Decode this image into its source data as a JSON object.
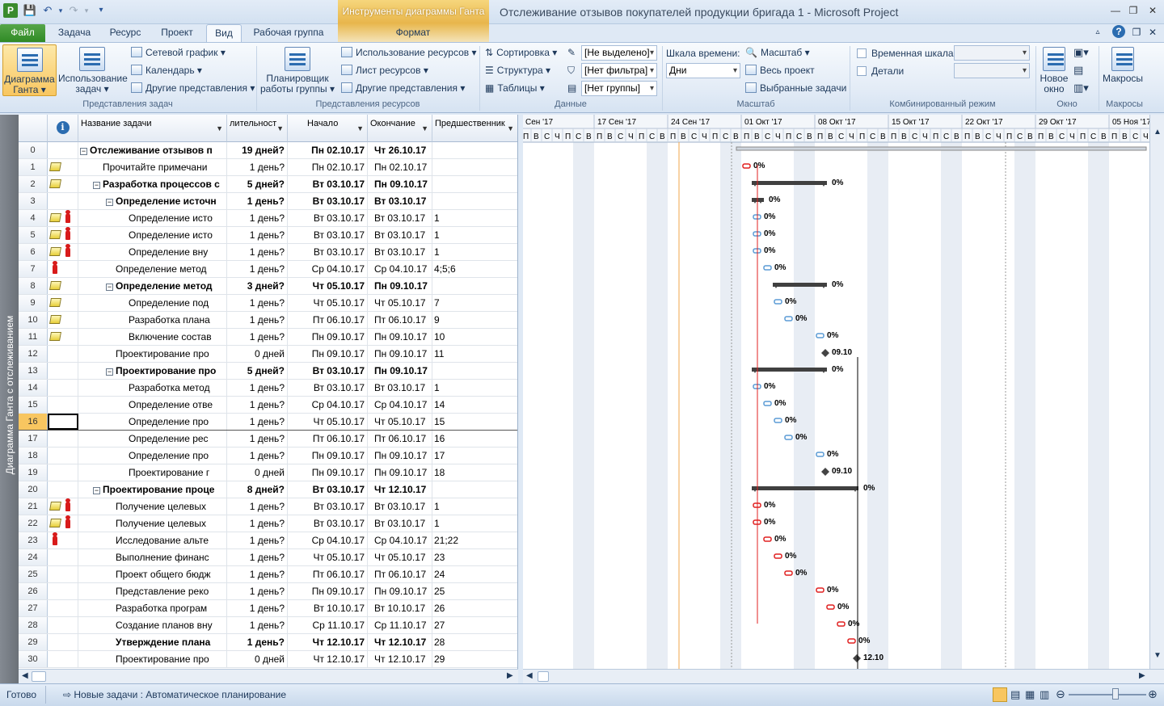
{
  "app": {
    "title": "Отслеживание отзывов покупателей продукции бригада 1  -  Microsoft Project",
    "context_tools": "Инструменты диаграммы Ганта",
    "logo": "P"
  },
  "tabs": [
    "Файл",
    "Задача",
    "Ресурс",
    "Проект",
    "Вид",
    "Рабочая группа",
    "Формат"
  ],
  "ribbon": {
    "task_views": {
      "gantt": "Диаграмма Ганта",
      "task_usage": "Использование задач",
      "network": "Сетевой график",
      "calendar": "Календарь",
      "other": "Другие представления",
      "label": "Представления задач"
    },
    "resource_views": {
      "planner": "Планировщик работы группы",
      "usage": "Использование ресурсов",
      "sheet": "Лист ресурсов",
      "other": "Другие представления",
      "label": "Представления ресурсов"
    },
    "data": {
      "sort": "Сортировка",
      "outline": "Структура",
      "tables": "Таблицы",
      "highlight": "[Не выделено]",
      "filter": "[Нет фильтра]",
      "group": "[Нет группы]",
      "label": "Данные"
    },
    "zoom": {
      "timescale": "Шкала времени:",
      "timescale_value": "Дни",
      "zoom": "Масштаб",
      "whole_project": "Весь проект",
      "selected": "Выбранные задачи",
      "label": "Масштаб"
    },
    "split": {
      "timeline": "Временная шкала",
      "details": "Детали",
      "label": "Комбинированный режим"
    },
    "window": {
      "new": "Новое окно",
      "label": "Окно"
    },
    "macros": {
      "btn": "Макросы",
      "label": "Макросы"
    }
  },
  "sidebar_label": "Диаграмма Ганта с отслеживанием",
  "columns": {
    "info": "i",
    "name": "Название задачи",
    "duration": "лительност",
    "start": "Начало",
    "finish": "Окончание",
    "pred": "Предшественник"
  },
  "timescale": {
    "weeks": [
      "Сен '17",
      "17 Сен '17",
      "24 Сен '17",
      "01 Окт '17",
      "08 Окт '17",
      "15 Окт '17",
      "22 Окт '17",
      "29 Окт '17",
      "05 Ноя '17"
    ],
    "days": [
      "П",
      "В",
      "С",
      "Ч",
      "П",
      "С",
      "В"
    ]
  },
  "tasks": [
    {
      "id": "0",
      "name": "Отслеживание отзывов п",
      "dur": "19 дней?",
      "start": "Пн 02.10.17",
      "finish": "Чт 26.10.17",
      "pred": "",
      "bold": true,
      "lvl": 0,
      "sum": true,
      "note": false,
      "res": false,
      "pct": "0%"
    },
    {
      "id": "1",
      "name": "Прочитайте примечани",
      "dur": "1 день?",
      "start": "Пн 02.10.17",
      "finish": "Пн 02.10.17",
      "pred": "",
      "bold": false,
      "lvl": 1,
      "sum": false,
      "note": true,
      "res": false,
      "pct": "0%"
    },
    {
      "id": "2",
      "name": "Разработка процессов с",
      "dur": "5 дней?",
      "start": "Вт 03.10.17",
      "finish": "Пн 09.10.17",
      "pred": "",
      "bold": true,
      "lvl": 1,
      "sum": true,
      "note": true,
      "res": false,
      "pct": "0%"
    },
    {
      "id": "3",
      "name": "Определение источн",
      "dur": "1 день?",
      "start": "Вт 03.10.17",
      "finish": "Вт 03.10.17",
      "pred": "",
      "bold": true,
      "lvl": 2,
      "sum": true,
      "note": false,
      "res": false,
      "pct": "0%"
    },
    {
      "id": "4",
      "name": "Определение исто",
      "dur": "1 день?",
      "start": "Вт 03.10.17",
      "finish": "Вт 03.10.17",
      "pred": "1",
      "bold": false,
      "lvl": 3,
      "sum": false,
      "note": true,
      "res": true,
      "pct": "0%"
    },
    {
      "id": "5",
      "name": "Определение исто",
      "dur": "1 день?",
      "start": "Вт 03.10.17",
      "finish": "Вт 03.10.17",
      "pred": "1",
      "bold": false,
      "lvl": 3,
      "sum": false,
      "note": true,
      "res": true,
      "pct": "0%"
    },
    {
      "id": "6",
      "name": "Определение вну",
      "dur": "1 день?",
      "start": "Вт 03.10.17",
      "finish": "Вт 03.10.17",
      "pred": "1",
      "bold": false,
      "lvl": 3,
      "sum": false,
      "note": true,
      "res": true,
      "pct": "0%"
    },
    {
      "id": "7",
      "name": "Определение метод",
      "dur": "1 день?",
      "start": "Ср 04.10.17",
      "finish": "Ср 04.10.17",
      "pred": "4;5;6",
      "bold": false,
      "lvl": 2,
      "sum": false,
      "note": false,
      "res": true,
      "pct": "0%"
    },
    {
      "id": "8",
      "name": "Определение метод",
      "dur": "3 дней?",
      "start": "Чт 05.10.17",
      "finish": "Пн 09.10.17",
      "pred": "",
      "bold": true,
      "lvl": 2,
      "sum": true,
      "note": true,
      "res": false,
      "pct": "0%"
    },
    {
      "id": "9",
      "name": "Определение под",
      "dur": "1 день?",
      "start": "Чт 05.10.17",
      "finish": "Чт 05.10.17",
      "pred": "7",
      "bold": false,
      "lvl": 3,
      "sum": false,
      "note": true,
      "res": false,
      "pct": "0%"
    },
    {
      "id": "10",
      "name": "Разработка плана",
      "dur": "1 день?",
      "start": "Пт 06.10.17",
      "finish": "Пт 06.10.17",
      "pred": "9",
      "bold": false,
      "lvl": 3,
      "sum": false,
      "note": true,
      "res": false,
      "pct": "0%"
    },
    {
      "id": "11",
      "name": "Включение состав",
      "dur": "1 день?",
      "start": "Пн 09.10.17",
      "finish": "Пн 09.10.17",
      "pred": "10",
      "bold": false,
      "lvl": 3,
      "sum": false,
      "note": true,
      "res": false,
      "pct": "0%"
    },
    {
      "id": "12",
      "name": "Проектирование про",
      "dur": "0 дней",
      "start": "Пн 09.10.17",
      "finish": "Пн 09.10.17",
      "pred": "11",
      "bold": false,
      "lvl": 2,
      "sum": false,
      "note": false,
      "res": false,
      "pct": "09.10"
    },
    {
      "id": "13",
      "name": "Проектирование про",
      "dur": "5 дней?",
      "start": "Вт 03.10.17",
      "finish": "Пн 09.10.17",
      "pred": "",
      "bold": true,
      "lvl": 2,
      "sum": true,
      "note": false,
      "res": false,
      "pct": "0%"
    },
    {
      "id": "14",
      "name": "Разработка метод",
      "dur": "1 день?",
      "start": "Вт 03.10.17",
      "finish": "Вт 03.10.17",
      "pred": "1",
      "bold": false,
      "lvl": 3,
      "sum": false,
      "note": false,
      "res": false,
      "pct": "0%"
    },
    {
      "id": "15",
      "name": "Определение отве",
      "dur": "1 день?",
      "start": "Ср 04.10.17",
      "finish": "Ср 04.10.17",
      "pred": "14",
      "bold": false,
      "lvl": 3,
      "sum": false,
      "note": false,
      "res": false,
      "pct": "0%"
    },
    {
      "id": "16",
      "name": "Определение про",
      "dur": "1 день?",
      "start": "Чт 05.10.17",
      "finish": "Чт 05.10.17",
      "pred": "15",
      "bold": false,
      "lvl": 3,
      "sum": false,
      "note": false,
      "res": false,
      "pct": "0%"
    },
    {
      "id": "17",
      "name": "Определение рес",
      "dur": "1 день?",
      "start": "Пт 06.10.17",
      "finish": "Пт 06.10.17",
      "pred": "16",
      "bold": false,
      "lvl": 3,
      "sum": false,
      "note": false,
      "res": false,
      "pct": "0%"
    },
    {
      "id": "18",
      "name": "Определение про",
      "dur": "1 день?",
      "start": "Пн 09.10.17",
      "finish": "Пн 09.10.17",
      "pred": "17",
      "bold": false,
      "lvl": 3,
      "sum": false,
      "note": false,
      "res": false,
      "pct": "0%"
    },
    {
      "id": "19",
      "name": "Проектирование г",
      "dur": "0 дней",
      "start": "Пн 09.10.17",
      "finish": "Пн 09.10.17",
      "pred": "18",
      "bold": false,
      "lvl": 3,
      "sum": false,
      "note": false,
      "res": false,
      "pct": "09.10"
    },
    {
      "id": "20",
      "name": "Проектирование проце",
      "dur": "8 дней?",
      "start": "Вт 03.10.17",
      "finish": "Чт 12.10.17",
      "pred": "",
      "bold": true,
      "lvl": 1,
      "sum": true,
      "note": false,
      "res": false,
      "pct": "0%"
    },
    {
      "id": "21",
      "name": "Получение целевых",
      "dur": "1 день?",
      "start": "Вт 03.10.17",
      "finish": "Вт 03.10.17",
      "pred": "1",
      "bold": false,
      "lvl": 2,
      "sum": false,
      "note": true,
      "res": true,
      "pct": "0%"
    },
    {
      "id": "22",
      "name": "Получение целевых",
      "dur": "1 день?",
      "start": "Вт 03.10.17",
      "finish": "Вт 03.10.17",
      "pred": "1",
      "bold": false,
      "lvl": 2,
      "sum": false,
      "note": true,
      "res": true,
      "pct": "0%"
    },
    {
      "id": "23",
      "name": "Исследование альте",
      "dur": "1 день?",
      "start": "Ср 04.10.17",
      "finish": "Ср 04.10.17",
      "pred": "21;22",
      "bold": false,
      "lvl": 2,
      "sum": false,
      "note": false,
      "res": true,
      "pct": "0%"
    },
    {
      "id": "24",
      "name": "Выполнение финанс",
      "dur": "1 день?",
      "start": "Чт 05.10.17",
      "finish": "Чт 05.10.17",
      "pred": "23",
      "bold": false,
      "lvl": 2,
      "sum": false,
      "note": false,
      "res": false,
      "pct": "0%"
    },
    {
      "id": "25",
      "name": "Проект общего бюдж",
      "dur": "1 день?",
      "start": "Пт 06.10.17",
      "finish": "Пт 06.10.17",
      "pred": "24",
      "bold": false,
      "lvl": 2,
      "sum": false,
      "note": false,
      "res": false,
      "pct": "0%"
    },
    {
      "id": "26",
      "name": "Представление реко",
      "dur": "1 день?",
      "start": "Пн 09.10.17",
      "finish": "Пн 09.10.17",
      "pred": "25",
      "bold": false,
      "lvl": 2,
      "sum": false,
      "note": false,
      "res": false,
      "pct": "0%"
    },
    {
      "id": "27",
      "name": "Разработка програм",
      "dur": "1 день?",
      "start": "Вт 10.10.17",
      "finish": "Вт 10.10.17",
      "pred": "26",
      "bold": false,
      "lvl": 2,
      "sum": false,
      "note": false,
      "res": false,
      "pct": "0%"
    },
    {
      "id": "28",
      "name": "Создание планов вну",
      "dur": "1 день?",
      "start": "Ср 11.10.17",
      "finish": "Ср 11.10.17",
      "pred": "27",
      "bold": false,
      "lvl": 2,
      "sum": false,
      "note": false,
      "res": false,
      "pct": "0%"
    },
    {
      "id": "29",
      "name": "Утверждение плана",
      "dur": "1 день?",
      "start": "Чт 12.10.17",
      "finish": "Чт 12.10.17",
      "pred": "28",
      "bold": true,
      "lvl": 2,
      "sum": false,
      "note": false,
      "res": false,
      "pct": "0%"
    },
    {
      "id": "30",
      "name": "Проектирование про",
      "dur": "0 дней",
      "start": "Чт 12.10.17",
      "finish": "Чт 12.10.17",
      "pred": "29",
      "bold": false,
      "lvl": 2,
      "sum": false,
      "note": false,
      "res": false,
      "pct": "12.10"
    }
  ],
  "selected_row": "16",
  "status": {
    "ready": "Готово",
    "mode": "Новые задачи : Автоматическое планирование"
  },
  "colors": {
    "critical": "#e02020",
    "normal": "#5b9bd5",
    "summary": "#404040",
    "accent": "#f8c660"
  }
}
